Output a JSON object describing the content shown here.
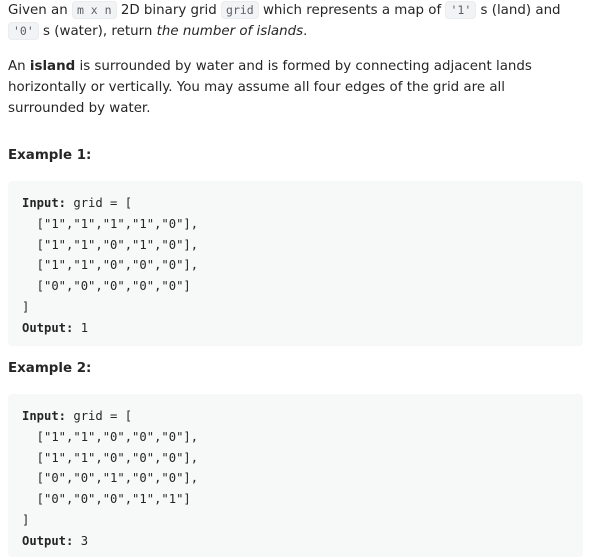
{
  "intro": {
    "p1_a": "Given an ",
    "p1_code1": "m x n",
    "p1_b": " 2D binary grid ",
    "p1_code2": "grid",
    "p1_c": " which represents a map of ",
    "p1_code3": "'1'",
    "p1_d": " s (land) and ",
    "p1_code4": "'0'",
    "p1_e": " s (water), return ",
    "p1_em": "the number of islands",
    "p1_f": ".",
    "p2_a": "An ",
    "p2_strong": "island",
    "p2_b": " is surrounded by water and is formed by connecting adjacent lands horizontally or vertically. You may assume all four edges of the grid are all surrounded by water."
  },
  "examples": [
    {
      "title": "Example 1:",
      "input_label": "Input:",
      "input_head": " grid = [",
      "rows": [
        "  [\"1\",\"1\",\"1\",\"1\",\"0\"],",
        "  [\"1\",\"1\",\"0\",\"1\",\"0\"],",
        "  [\"1\",\"1\",\"0\",\"0\",\"0\"],",
        "  [\"0\",\"0\",\"0\",\"0\",\"0\"]"
      ],
      "close": "]",
      "output_label": "Output:",
      "output_value": " 1"
    },
    {
      "title": "Example 2:",
      "input_label": "Input:",
      "input_head": " grid = [",
      "rows": [
        "  [\"1\",\"1\",\"0\",\"0\",\"0\"],",
        "  [\"1\",\"1\",\"0\",\"0\",\"0\"],",
        "  [\"0\",\"0\",\"1\",\"0\",\"0\"],",
        "  [\"0\",\"0\",\"0\",\"1\",\"1\"]"
      ],
      "close": "]",
      "output_label": "Output:",
      "output_value": " 3"
    }
  ]
}
